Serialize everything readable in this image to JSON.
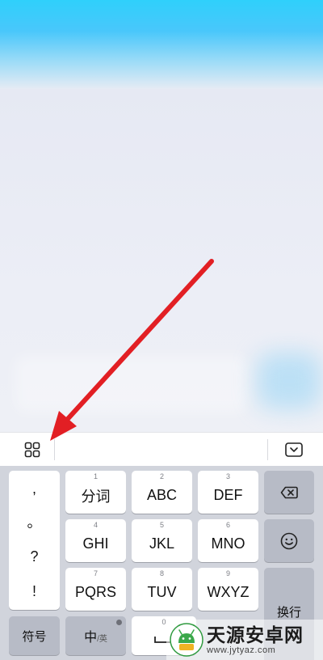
{
  "colors": {
    "header_blue": "#2fd0fb",
    "keyboard_bg": "#d1d4dc",
    "function_key": "#b7bbc6",
    "arrow_red": "#e21f24"
  },
  "toolbar": {
    "left_icon": "grid-apps-icon",
    "right_icon": "keyboard-hide-icon"
  },
  "punctuation": [
    ",",
    "。",
    "?",
    "!"
  ],
  "keys": [
    {
      "num": "1",
      "label": "分词"
    },
    {
      "num": "2",
      "label": "ABC"
    },
    {
      "num": "3",
      "label": "DEF"
    },
    {
      "num": "4",
      "label": "GHI"
    },
    {
      "num": "5",
      "label": "JKL"
    },
    {
      "num": "6",
      "label": "MNO"
    },
    {
      "num": "7",
      "label": "PQRS"
    },
    {
      "num": "8",
      "label": "TUV"
    },
    {
      "num": "9",
      "label": "WXYZ"
    }
  ],
  "right_keys": {
    "delete_icon": "backspace-icon",
    "emoji_icon": "smiley-icon",
    "enter_label": "换行"
  },
  "bottom_row": {
    "symbols_label": "符号",
    "lang_main": "中",
    "lang_sub": "/英",
    "space_num": "0",
    "space_icon": "space-bar-icon"
  },
  "watermark": {
    "name": "天源安卓网",
    "url": "www.jytyaz.com"
  }
}
